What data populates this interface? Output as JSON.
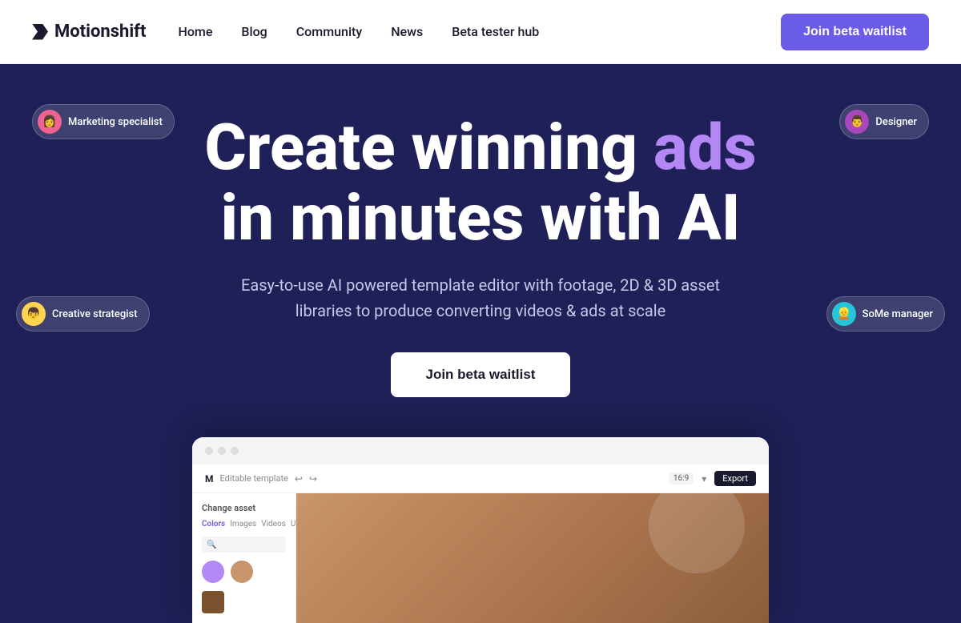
{
  "brand": {
    "name": "Motionshift"
  },
  "navbar": {
    "links": [
      {
        "id": "home",
        "label": "Home"
      },
      {
        "id": "blog",
        "label": "Blog"
      },
      {
        "id": "community",
        "label": "Community"
      },
      {
        "id": "news",
        "label": "News"
      },
      {
        "id": "beta-tester-hub",
        "label": "Beta tester hub"
      }
    ],
    "cta": "Join beta waitlist"
  },
  "hero": {
    "title_part1": "Create winning",
    "title_accent": "ads",
    "title_part2": "in minutes with AI",
    "subtitle": "Easy-to-use AI powered template editor with footage, 2D & 3D asset libraries to produce converting videos & ads at scale",
    "cta": "Join beta waitlist",
    "badges": [
      {
        "id": "marketing-specialist",
        "label": "Marketing specialist",
        "avatar_emoji": "👩",
        "color": "pink"
      },
      {
        "id": "designer",
        "label": "Designer",
        "avatar_emoji": "👨",
        "color": "purple"
      },
      {
        "id": "creative-strategist",
        "label": "Creative strategist",
        "avatar_emoji": "👦",
        "color": "yellow"
      },
      {
        "id": "some-manager",
        "label": "SoMe manager",
        "avatar_emoji": "👱",
        "color": "teal"
      }
    ]
  },
  "mockup": {
    "template_label": "Editable template",
    "sidebar_title": "Change asset",
    "tabs": [
      "Colors",
      "Images",
      "Videos",
      "Upload"
    ],
    "search_placeholder": "🔍",
    "ratio": "16:9",
    "export_label": "Export",
    "colors": [
      "#b388f4",
      "#c9956a"
    ]
  }
}
